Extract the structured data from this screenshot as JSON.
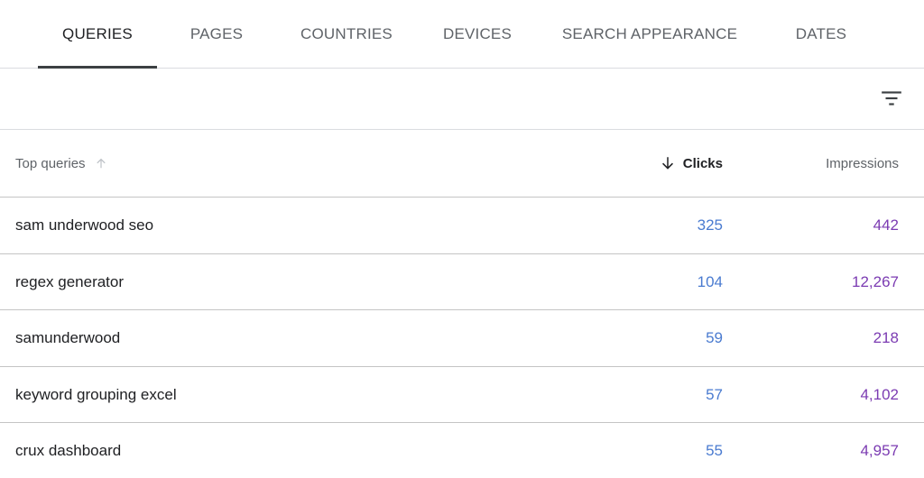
{
  "tabs": [
    {
      "label": "QUERIES",
      "active": true
    },
    {
      "label": "PAGES",
      "active": false
    },
    {
      "label": "COUNTRIES",
      "active": false
    },
    {
      "label": "DEVICES",
      "active": false
    },
    {
      "label": "SEARCH APPEARANCE",
      "active": false
    },
    {
      "label": "DATES",
      "active": false
    }
  ],
  "filter": {
    "icon": "filter-icon"
  },
  "table": {
    "headers": {
      "query": "Top queries",
      "clicks": "Clicks",
      "impressions": "Impressions"
    },
    "sort": {
      "column": "clicks",
      "direction": "descending"
    },
    "rows": [
      {
        "query": "sam underwood seo",
        "clicks": "325",
        "impressions": "442"
      },
      {
        "query": "regex generator",
        "clicks": "104",
        "impressions": "12,267"
      },
      {
        "query": "samunderwood",
        "clicks": "59",
        "impressions": "218"
      },
      {
        "query": "keyword grouping excel",
        "clicks": "57",
        "impressions": "4,102"
      },
      {
        "query": "crux dashboard",
        "clicks": "55",
        "impressions": "4,957"
      }
    ]
  },
  "colors": {
    "clicks": "#4a7bd0",
    "impressions": "#7b3bb2",
    "active_tab_indicator": "#3c4043"
  }
}
